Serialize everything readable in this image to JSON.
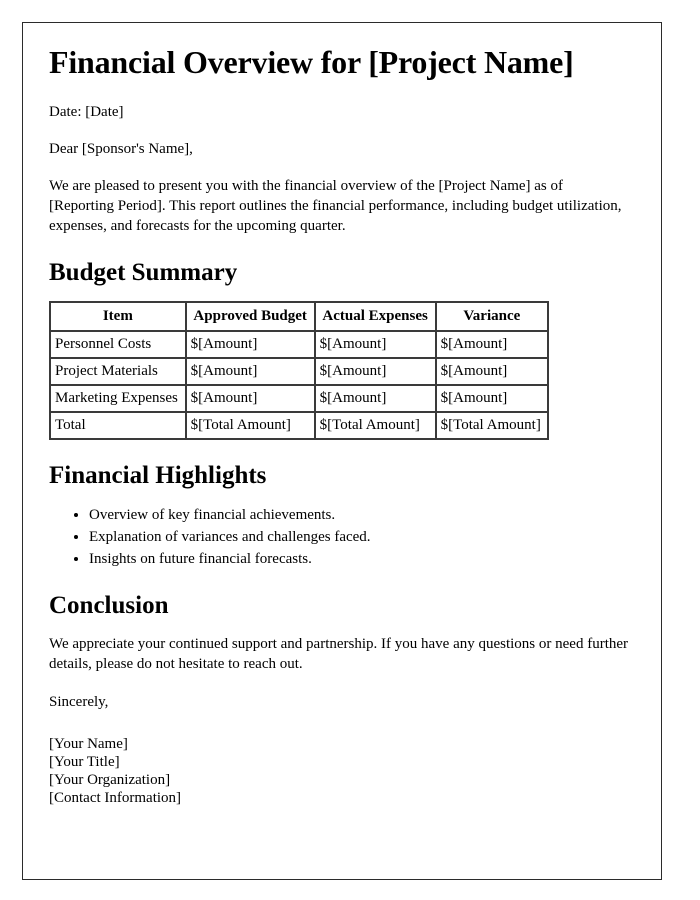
{
  "document": {
    "title": "Financial Overview for [Project Name]",
    "date_line": "Date: [Date]",
    "salutation": "Dear [Sponsor's Name],",
    "intro_paragraph": "We are pleased to present you with the financial overview of the [Project Name] as of [Reporting Period]. This report outlines the financial performance, including budget utilization, expenses, and forecasts for the upcoming quarter."
  },
  "budget_summary": {
    "heading": "Budget Summary",
    "columns": [
      "Item",
      "Approved Budget",
      "Actual Expenses",
      "Variance"
    ],
    "rows": [
      [
        "Personnel Costs",
        "$[Amount]",
        "$[Amount]",
        "$[Amount]"
      ],
      [
        "Project Materials",
        "$[Amount]",
        "$[Amount]",
        "$[Amount]"
      ],
      [
        "Marketing Expenses",
        "$[Amount]",
        "$[Amount]",
        "$[Amount]"
      ],
      [
        "Total",
        "$[Total Amount]",
        "$[Total Amount]",
        "$[Total Amount]"
      ]
    ]
  },
  "financial_highlights": {
    "heading": "Financial Highlights",
    "items": [
      "Overview of key financial achievements.",
      "Explanation of variances and challenges faced.",
      "Insights on future financial forecasts."
    ]
  },
  "conclusion": {
    "heading": "Conclusion",
    "paragraph": "We appreciate your continued support and partnership. If you have any questions or need further details, please do not hesitate to reach out.",
    "closing": "Sincerely,"
  },
  "signature": {
    "lines": [
      "[Your Name]",
      "[Your Title]",
      "[Your Organization]",
      "[Contact Information]"
    ]
  }
}
